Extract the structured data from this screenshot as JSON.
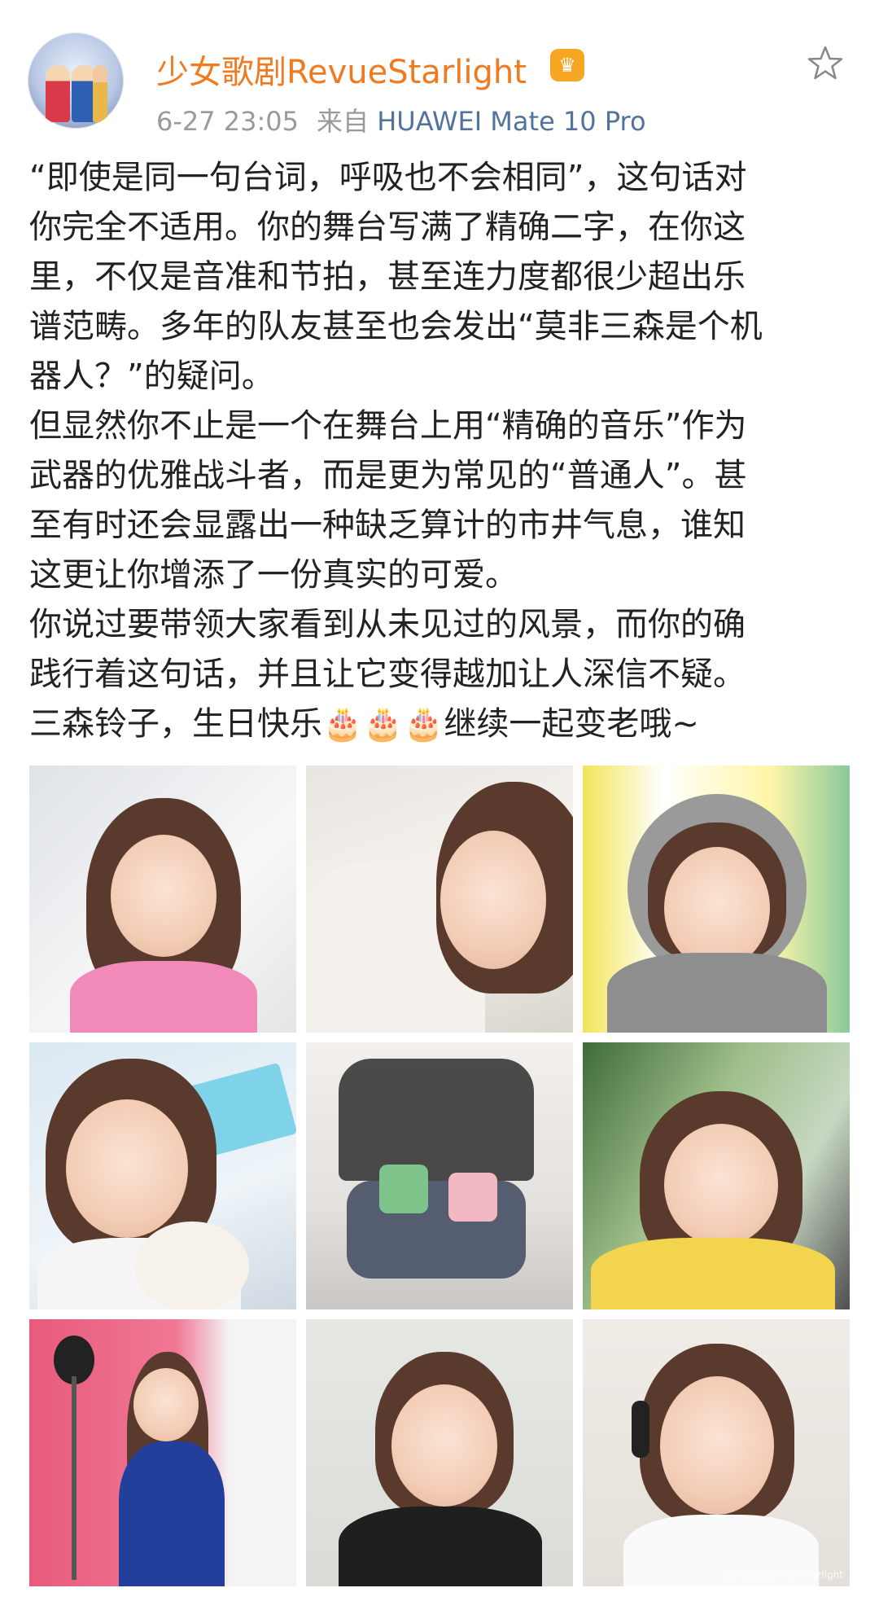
{
  "post": {
    "username": "少女歌剧RevueStarlight",
    "timestamp": "6-27 23:05",
    "source_prefix": "来自",
    "device": "HUAWEI Mate 10 Pro",
    "badge_icon": "crown-icon",
    "favorite_icon": "star-outline-icon",
    "text": "“即使是同一句台词，呼吸也不会相同”，这句话对\n你完全不适用。你的舞台写满了精确二字，在你这\n里，不仅是音准和节拍，甚至连力度都很少超出乐\n谱范畴。多年的队友甚至也会发出“莫非三森是个机\n器人？”的疑问。\n但显然你不止是一个在舞台上用“精确的音乐”作为\n武器的优雅战斗者，而是更为常见的“普通人”。甚\n至有时还会显露出一种缺乏算计的市井气息，谁知\n这更让你增添了一份真实的可爱。\n你说过要带领大家看到从未见过的风景，而你的确\n践行着这句话，并且让它变得越加让人深信不疑。\n三森铃子，生日快乐🎂🎂🎂继续一起变老哦~",
    "watermark": "@少女歌剧RevueStarlight"
  },
  "colors": {
    "username": "#f07a20",
    "meta": "#9a9a9a",
    "device": "#51739e",
    "text": "#222222"
  }
}
